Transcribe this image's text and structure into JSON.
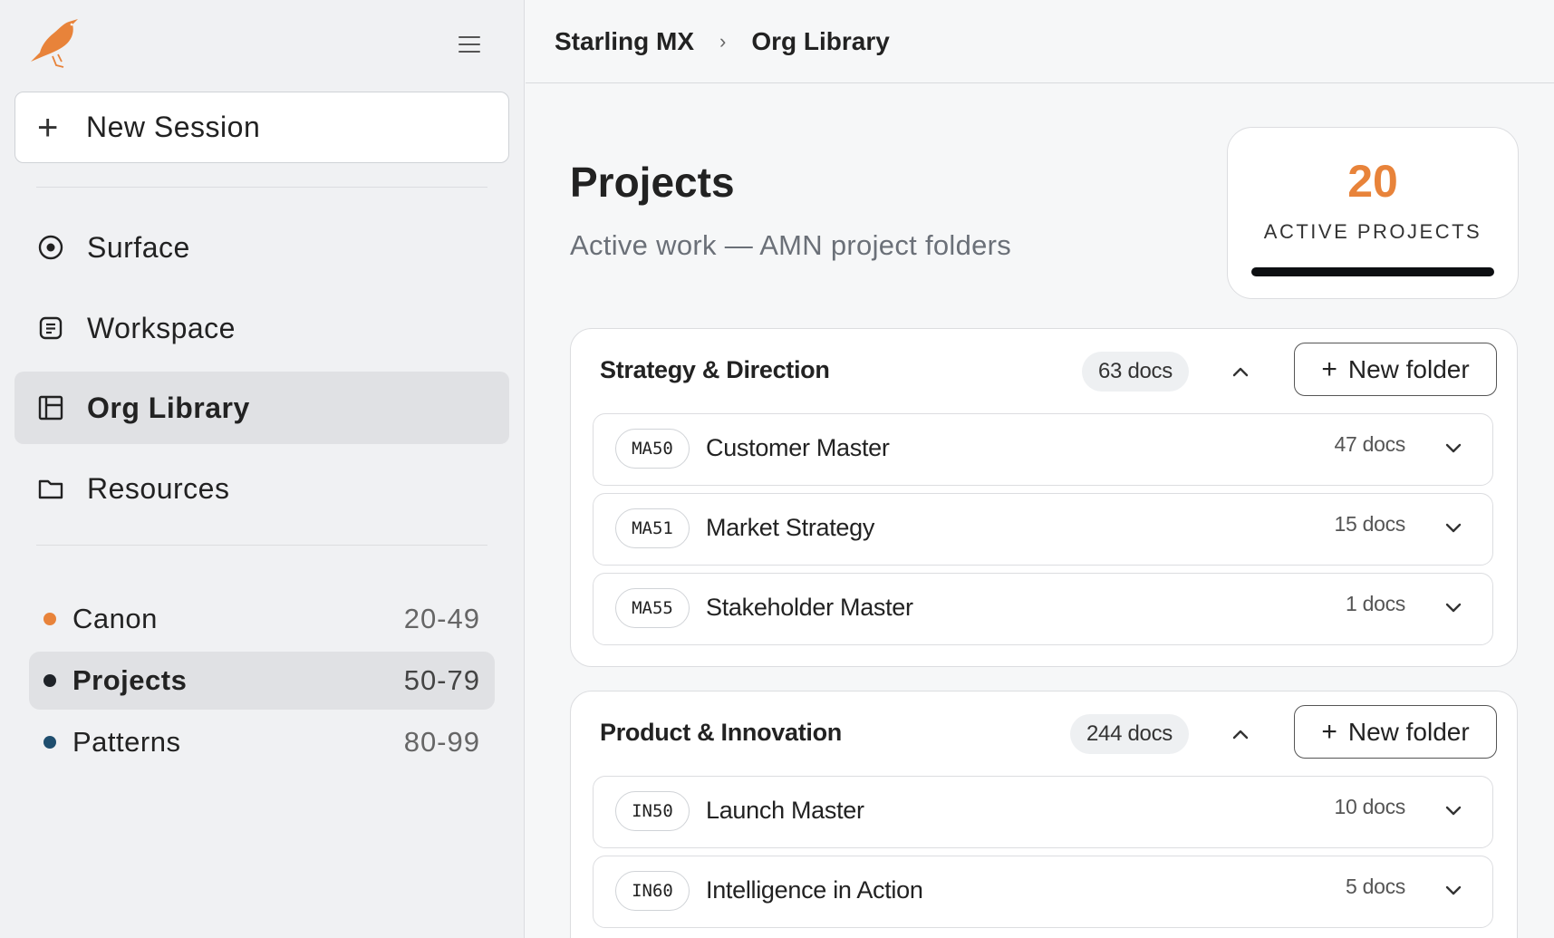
{
  "sidebar": {
    "new_session_label": "New Session",
    "nav": [
      {
        "label": "Surface",
        "icon": "target-icon"
      },
      {
        "label": "Workspace",
        "icon": "document-icon"
      },
      {
        "label": "Org Library",
        "icon": "library-icon",
        "active": true
      },
      {
        "label": "Resources",
        "icon": "folder-icon"
      }
    ],
    "ranges": [
      {
        "label": "Canon",
        "range": "20-49",
        "color": "#e8833a"
      },
      {
        "label": "Projects",
        "range": "50-79",
        "color": "#1f2328",
        "active": true
      },
      {
        "label": "Patterns",
        "range": "80-99",
        "color": "#1f4e6e"
      }
    ]
  },
  "breadcrumb": {
    "root": "Starling MX",
    "separator": "›",
    "current": "Org Library"
  },
  "header": {
    "title": "Projects",
    "subtitle": "Active work — AMN project folders"
  },
  "stat": {
    "value": "20",
    "label": "ACTIVE PROJECTS"
  },
  "groups": [
    {
      "title": "Strategy & Direction",
      "count": "63 docs",
      "new_folder_label": "New folder",
      "items": [
        {
          "code": "MA50",
          "name": "Customer Master",
          "count": "47 docs"
        },
        {
          "code": "MA51",
          "name": "Market Strategy",
          "count": "15 docs"
        },
        {
          "code": "MA55",
          "name": "Stakeholder Master",
          "count": "1 docs"
        }
      ]
    },
    {
      "title": "Product & Innovation",
      "count": "244 docs",
      "new_folder_label": "New folder",
      "items": [
        {
          "code": "IN50",
          "name": "Launch Master",
          "count": "10 docs"
        },
        {
          "code": "IN60",
          "name": "Intelligence in Action",
          "count": "5 docs"
        }
      ]
    }
  ],
  "colors": {
    "accent": "#e8833a",
    "sidebar_bg": "#f0f1f3",
    "main_bg": "#f6f7f8"
  }
}
